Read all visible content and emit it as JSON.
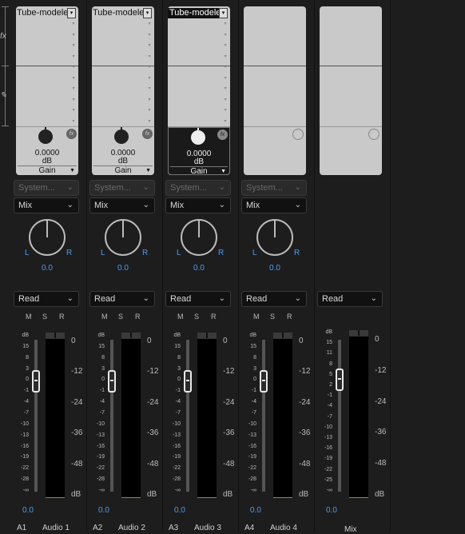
{
  "side": {
    "glyphs": [
      "fx",
      "✎"
    ]
  },
  "tracks": [
    {
      "id": "A1",
      "name": "Audio 1",
      "effect": "Tube-modele",
      "gain_value": "0.0000",
      "gain_unit": "dB",
      "gain_label": "Gain",
      "send": "System...",
      "mix_mode": "Mix",
      "pan_l": "L",
      "pan_r": "R",
      "pan_value": "0.0",
      "automation": "Read",
      "m": "M",
      "s": "S",
      "r": "R",
      "volume": "0.0"
    },
    {
      "id": "A2",
      "name": "Audio 2",
      "effect": "Tube-modele",
      "gain_value": "0.0000",
      "gain_unit": "dB",
      "gain_label": "Gain",
      "send": "System...",
      "mix_mode": "Mix",
      "pan_l": "L",
      "pan_r": "R",
      "pan_value": "0.0",
      "automation": "Read",
      "m": "M",
      "s": "S",
      "r": "R",
      "volume": "0.0"
    },
    {
      "id": "A3",
      "name": "Audio 3",
      "effect": "Tube-modele",
      "gain_value": "0.0000",
      "gain_unit": "dB",
      "gain_label": "Gain",
      "send": "System...",
      "mix_mode": "Mix",
      "pan_l": "L",
      "pan_r": "R",
      "pan_value": "0.0",
      "automation": "Read",
      "m": "M",
      "s": "S",
      "r": "R",
      "volume": "0.0"
    },
    {
      "id": "A4",
      "name": "Audio 4",
      "send": "System...",
      "mix_mode": "Mix",
      "pan_l": "L",
      "pan_r": "R",
      "pan_value": "0.0",
      "automation": "Read",
      "m": "M",
      "s": "S",
      "r": "R",
      "volume": "0.0"
    }
  ],
  "master": {
    "name": "Mix",
    "automation": "Read",
    "volume": "0.0"
  },
  "fader_scale": [
    "dB",
    "15",
    "8",
    "3",
    "0",
    "-1",
    "-4",
    "-7",
    "-10",
    "-13",
    "-16",
    "-19",
    "-22",
    "-28",
    "-∞"
  ],
  "master_scale": [
    "dB",
    "15",
    "11",
    "8",
    "5",
    "2",
    "-1",
    "-4",
    "-7",
    "-10",
    "-13",
    "-16",
    "-19",
    "-22",
    "-25",
    "-∞"
  ],
  "meter_scale": [
    "0",
    "-12",
    "-24",
    "-36",
    "-48",
    "dB"
  ],
  "colors": {
    "background": "#1d1d1d",
    "accent_blue": "#4d9bf0"
  }
}
